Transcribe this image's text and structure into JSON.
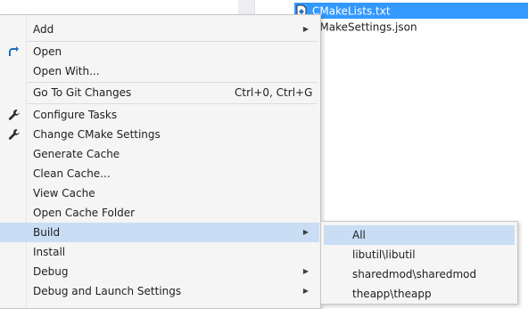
{
  "solution_explorer": {
    "items": [
      {
        "label": "CMakeLists.txt",
        "selected": true,
        "icon": "cmake-file-icon"
      },
      {
        "label": "CMakeSettings.json",
        "selected": false,
        "icon": "json-file-icon"
      }
    ]
  },
  "context_menu": {
    "items": [
      {
        "label": "Add",
        "submenu": true
      },
      {
        "label": "Open",
        "icon": "open-arrow-icon"
      },
      {
        "label": "Open With..."
      },
      {
        "label": "Go To Git Changes",
        "shortcut": "Ctrl+0, Ctrl+G"
      },
      {
        "label": "Configure Tasks",
        "icon": "wrench-icon"
      },
      {
        "label": "Change CMake Settings",
        "icon": "wrench-icon"
      },
      {
        "label": "Generate Cache"
      },
      {
        "label": "Clean Cache..."
      },
      {
        "label": "View Cache"
      },
      {
        "label": "Open Cache Folder"
      },
      {
        "label": "Build",
        "submenu": true,
        "highlighted": true
      },
      {
        "label": "Install"
      },
      {
        "label": "Debug",
        "submenu": true
      },
      {
        "label": "Debug and Launch Settings",
        "submenu": true
      }
    ]
  },
  "build_submenu": {
    "items": [
      {
        "label": "All",
        "highlighted": true
      },
      {
        "label": "libutil\\libutil"
      },
      {
        "label": "sharedmod\\sharedmod"
      },
      {
        "label": "theapp\\theapp"
      }
    ]
  },
  "colors": {
    "selection": "#3399ff",
    "menu_highlight": "#c9def5",
    "menu_background": "#f5f5f5",
    "open_icon": "#1e6fc0"
  }
}
